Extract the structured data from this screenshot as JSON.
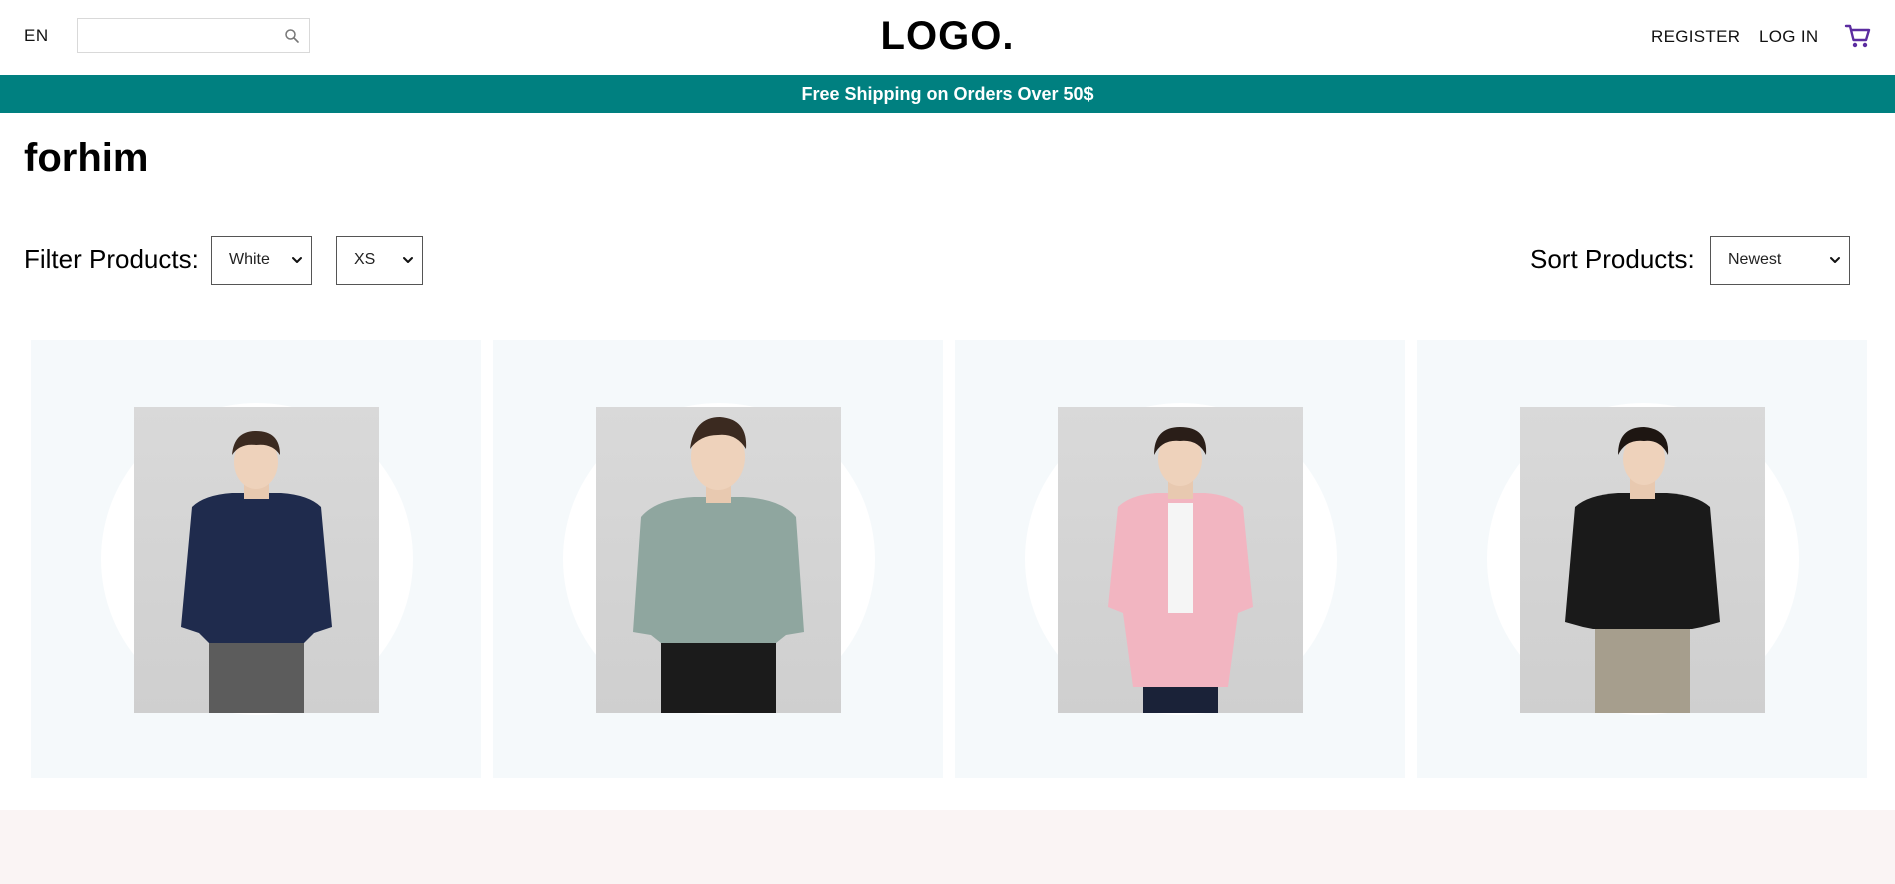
{
  "header": {
    "language": "EN",
    "search": {
      "value": "",
      "placeholder": ""
    },
    "logo": "LOGO.",
    "register": "REGISTER",
    "login": "LOG IN",
    "cart_icon": "cart-icon",
    "search_icon": "search-icon"
  },
  "banner": {
    "text": "Free Shipping on Orders Over 50$"
  },
  "page": {
    "title": "forhim"
  },
  "filters": {
    "label": "Filter Products:",
    "color": {
      "selected": "White"
    },
    "size": {
      "selected": "XS"
    }
  },
  "sort": {
    "label": "Sort Products:",
    "selected": "Newest"
  },
  "colors": {
    "banner": "#008080",
    "card_bg": "#f5f9fb",
    "cart_icon": "#5b2ca0",
    "footer_bg": "#faf4f4"
  },
  "products": [
    {
      "shirt_color": "#1f2b4d",
      "pants_color": "#5c5c5c"
    },
    {
      "shirt_color": "#8fa69f",
      "pants_color": "#1b1b1b"
    },
    {
      "shirt_color": "#f2b5c1",
      "pants_color": "#1a2238"
    },
    {
      "shirt_color": "#1a1a1a",
      "pants_color": "#a69e8d"
    }
  ]
}
